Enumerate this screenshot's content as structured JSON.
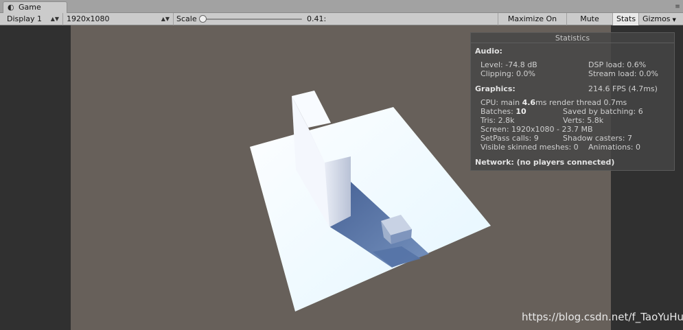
{
  "tab": {
    "icon": "unity-logo-icon",
    "label": "Game"
  },
  "toolbar": {
    "display": "Display 1",
    "resolution": "1920x1080",
    "scale_label": "Scale",
    "scale_value": "0.41:",
    "scale_fraction": 0.0,
    "buttons": {
      "maximize": "Maximize On Play",
      "mute": "Mute Audio",
      "stats": "Stats",
      "gizmos": "Gizmos"
    }
  },
  "stats": {
    "title": "Statistics",
    "audio": {
      "heading": "Audio:",
      "level": "Level: -74.8 dB",
      "dsp": "DSP load: 0.6%",
      "clipping": "Clipping: 0.0%",
      "stream": "Stream load: 0.0%"
    },
    "graphics": {
      "heading": "Graphics:",
      "fps": "214.6 FPS (4.7ms)",
      "cpu_prefix": "CPU: main ",
      "cpu_main": "4.6",
      "cpu_suffix": "ms  render thread 0.7ms",
      "batches_prefix": "Batches: ",
      "batches": "10",
      "saved": "Saved by batching: 6",
      "tris": "Tris: 2.8k",
      "verts": "Verts: 5.8k",
      "screen": "Screen: 1920x1080 - 23.7 MB",
      "setpass": "SetPass calls: 9",
      "shadow": "Shadow casters: 7",
      "skinned": "Visible skinned meshes: 0",
      "animations": "Animations: 0"
    },
    "network": "Network: (no players connected)"
  },
  "watermark": "https://blog.csdn.net/f_TaoYuHu",
  "colors": {
    "game_bg": "#67605a",
    "plane": "#f2f8ff",
    "shadow": "#4e6692"
  }
}
